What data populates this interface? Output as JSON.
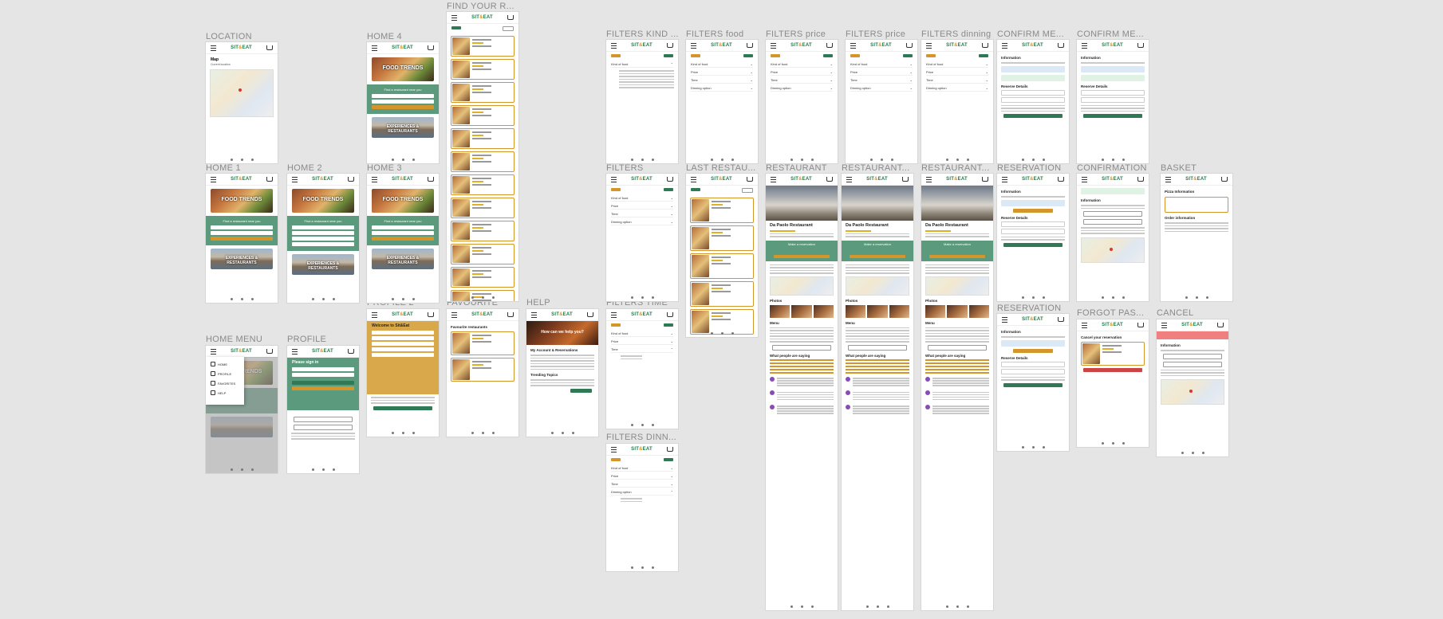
{
  "canvas": {
    "background": "#e5e5e5"
  },
  "brand": {
    "logo_left": "SIT",
    "logo_mid": "&",
    "logo_right": "EAT",
    "green": "#2f7a55",
    "orange": "#d4952b",
    "sage": "#5c9a7d"
  },
  "labels": {
    "location": "LOCATION",
    "home4": "HOME 4",
    "find": "FIND YOUR R...",
    "filters_kind": "FILTERS KIND ...",
    "filters_food": "FILTERS food",
    "filters_price1": "FILTERS price",
    "filters_price2": "FILTERS price",
    "filters_dinning": "FILTERS dinning",
    "confirm_me1": "CONFIRM ME...",
    "confirm_me2": "CONFIRM ME...",
    "home1": "HOME 1",
    "home2": "HOME 2",
    "home3": "HOME 3",
    "filters": "FILTERS",
    "last_restau": "LAST RESTAU...",
    "restaurant1": "RESTAURANT",
    "restaurant2": "RESTAURANT...",
    "restaurant3": "RESTAURANT...",
    "reservation1": "RESERVATION",
    "confirmation": "CONFIRMATION",
    "basket": "BASKET",
    "profile2": "PROFILE 2",
    "favourite": "FAVOURITE",
    "help": "HELP",
    "filters_time": "FILTERS TIME",
    "reservation2": "RESERVATION",
    "forgot_pas": "FORGOT PAS...",
    "cancel": "CANCEL",
    "home_menu": "HOME MENU",
    "profile": "PROFILE",
    "filters_dinn": "FILTERS DINN..."
  },
  "screens": {
    "location": {
      "title": "Map",
      "sub": "Current location"
    },
    "home": {
      "hero": "FOOD TRENDS",
      "find": "Find a restaurant near you",
      "search": "Let's go",
      "city": "EXPERIENCES & RESTAURANTS"
    },
    "restaurant": {
      "name": "Da Paolo Restaurant",
      "make": "Make a reservation",
      "photos": "Photos",
      "menu": "Menu",
      "reviews": "What people are saying"
    },
    "info": {
      "title": "Information",
      "reserve": "Reserve Details",
      "complete": "Complete reserve"
    },
    "basket": {
      "title": "Pizza Information",
      "order": "Order information"
    },
    "profile": {
      "signin": "Please sign in"
    },
    "profile2": {
      "welcome": "Welcome to Sit&Eat"
    },
    "favourite": {
      "title": "Favourite restaurants"
    },
    "help": {
      "hero": "How can we help you?",
      "q": "My Account & Reservations",
      "topics": "Trending Topics"
    },
    "forgot": {
      "title": "Cancel your reservation"
    },
    "cancel": {
      "title": "Information"
    },
    "menu": {
      "items": [
        "HOME",
        "PROFILE",
        "FAVORITES",
        "HELP"
      ]
    },
    "filters": {
      "rows": [
        "Kind of food",
        "Price",
        "Time",
        "Dinning option"
      ]
    }
  }
}
